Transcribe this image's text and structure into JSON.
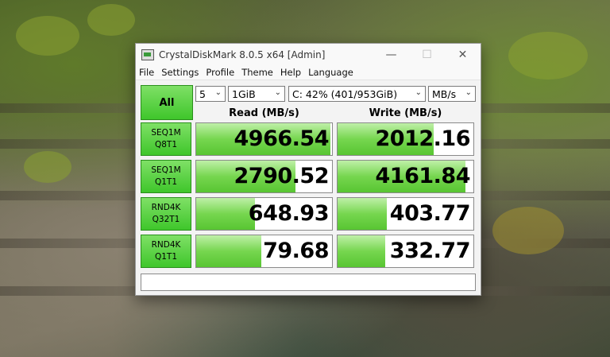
{
  "window": {
    "title": "CrystalDiskMark 8.0.5 x64 [Admin]",
    "minimize": "—",
    "maximize": "☐",
    "close": "✕"
  },
  "menu": [
    "File",
    "Settings",
    "Profile",
    "Theme",
    "Help",
    "Language"
  ],
  "controls": {
    "all_label": "All",
    "count": "5",
    "size": "1GiB",
    "drive": "C: 42% (401/953GiB)",
    "unit": "MB/s"
  },
  "headers": {
    "read": "Read (MB/s)",
    "write": "Write (MB/s)"
  },
  "max_scale": 5000,
  "rows": [
    {
      "line1": "SEQ1M",
      "line2": "Q8T1",
      "read": "4966.54",
      "write": "2012.16"
    },
    {
      "line1": "SEQ1M",
      "line2": "Q1T1",
      "read": "2790.52",
      "write": "4161.84"
    },
    {
      "line1": "RND4K",
      "line2": "Q32T1",
      "read": "648.93",
      "write": "403.77"
    },
    {
      "line1": "RND4K",
      "line2": "Q1T1",
      "read": "79.68",
      "write": "332.77"
    }
  ],
  "bar_fill": [
    {
      "read": 0.99,
      "write": 0.71
    },
    {
      "read": 0.73,
      "write": 0.94
    },
    {
      "read": 0.43,
      "write": 0.36
    },
    {
      "read": 0.48,
      "write": 0.35
    }
  ],
  "comment": ""
}
